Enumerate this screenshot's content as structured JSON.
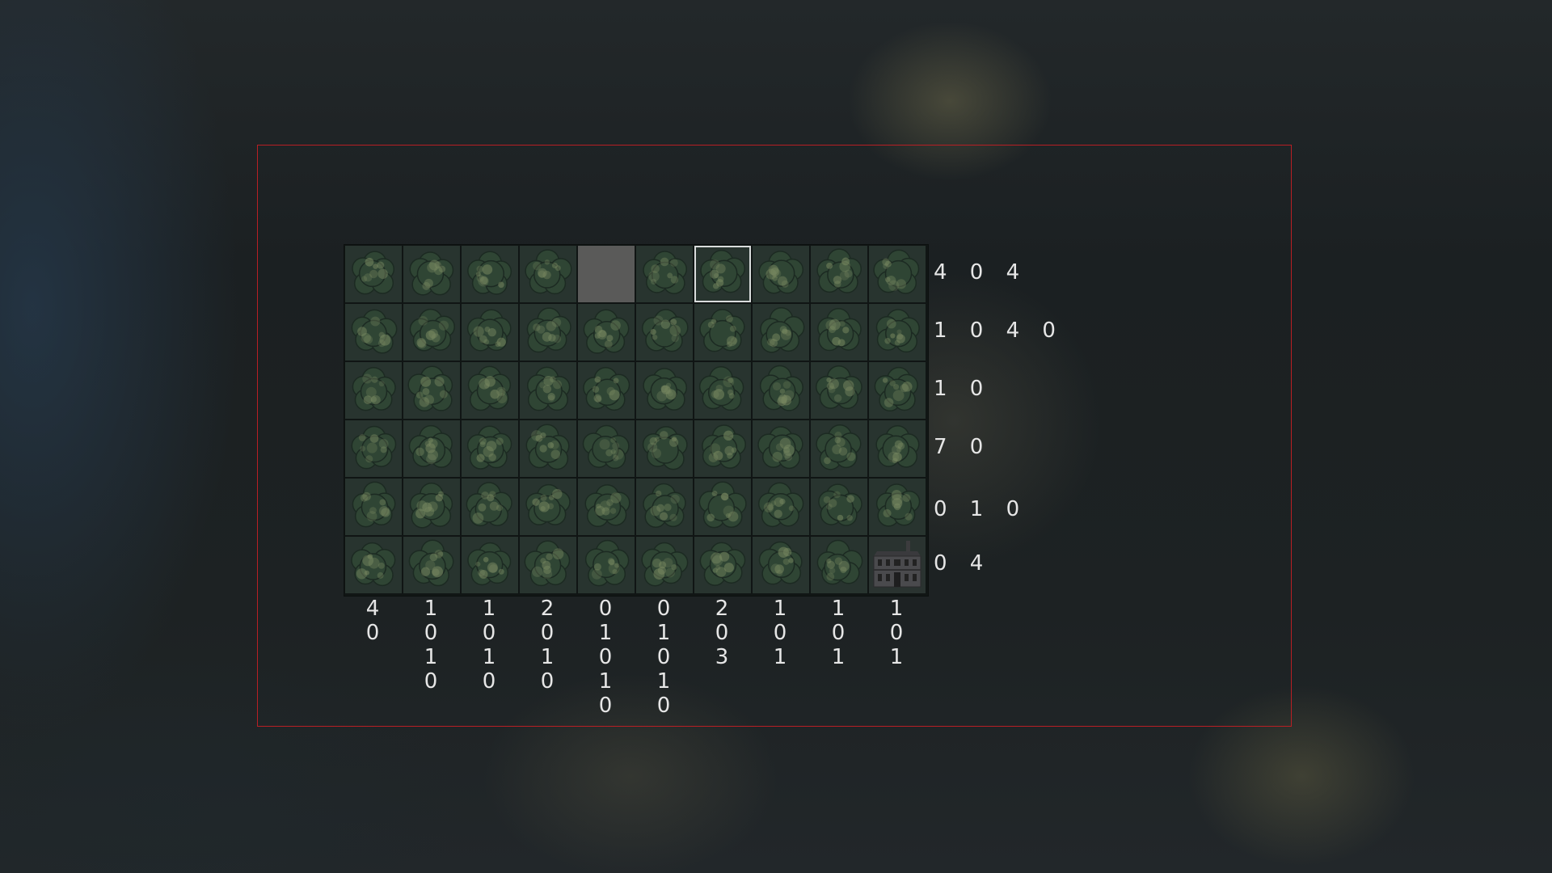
{
  "board": {
    "rows": 6,
    "cols": 10,
    "tile": "forest",
    "revealed_cells": [
      [
        0,
        4
      ]
    ],
    "selected_cells": [
      [
        0,
        6
      ]
    ],
    "building_cells": [
      [
        5,
        9
      ]
    ]
  },
  "row_clues": [
    "4 0 4",
    "1 0 4 0",
    "1 0",
    "7 0",
    "0 1 0",
    "0 4"
  ],
  "col_clues": [
    [
      "4",
      "0"
    ],
    [
      "1",
      "0",
      "1",
      "0"
    ],
    [
      "1",
      "0",
      "1",
      "0"
    ],
    [
      "2",
      "0",
      "1",
      "0"
    ],
    [
      "0",
      "1",
      "0",
      "1",
      "0"
    ],
    [
      "0",
      "1",
      "0",
      "1",
      "0"
    ],
    [
      "2",
      "0",
      "3"
    ],
    [
      "1",
      "0",
      "1"
    ],
    [
      "1",
      "0",
      "1"
    ],
    [
      "1",
      "0",
      "1"
    ]
  ],
  "colors": {
    "frame": "#b81f24",
    "clue_text": "#e6e6e6",
    "tree_dark": "#2f4534",
    "tree_light": "#7a8a62",
    "revealed": "#5a5a59",
    "selected_outline": "#d9dcdc"
  },
  "icons": {
    "tree": "tree-canopy-icon",
    "building": "house-icon"
  }
}
